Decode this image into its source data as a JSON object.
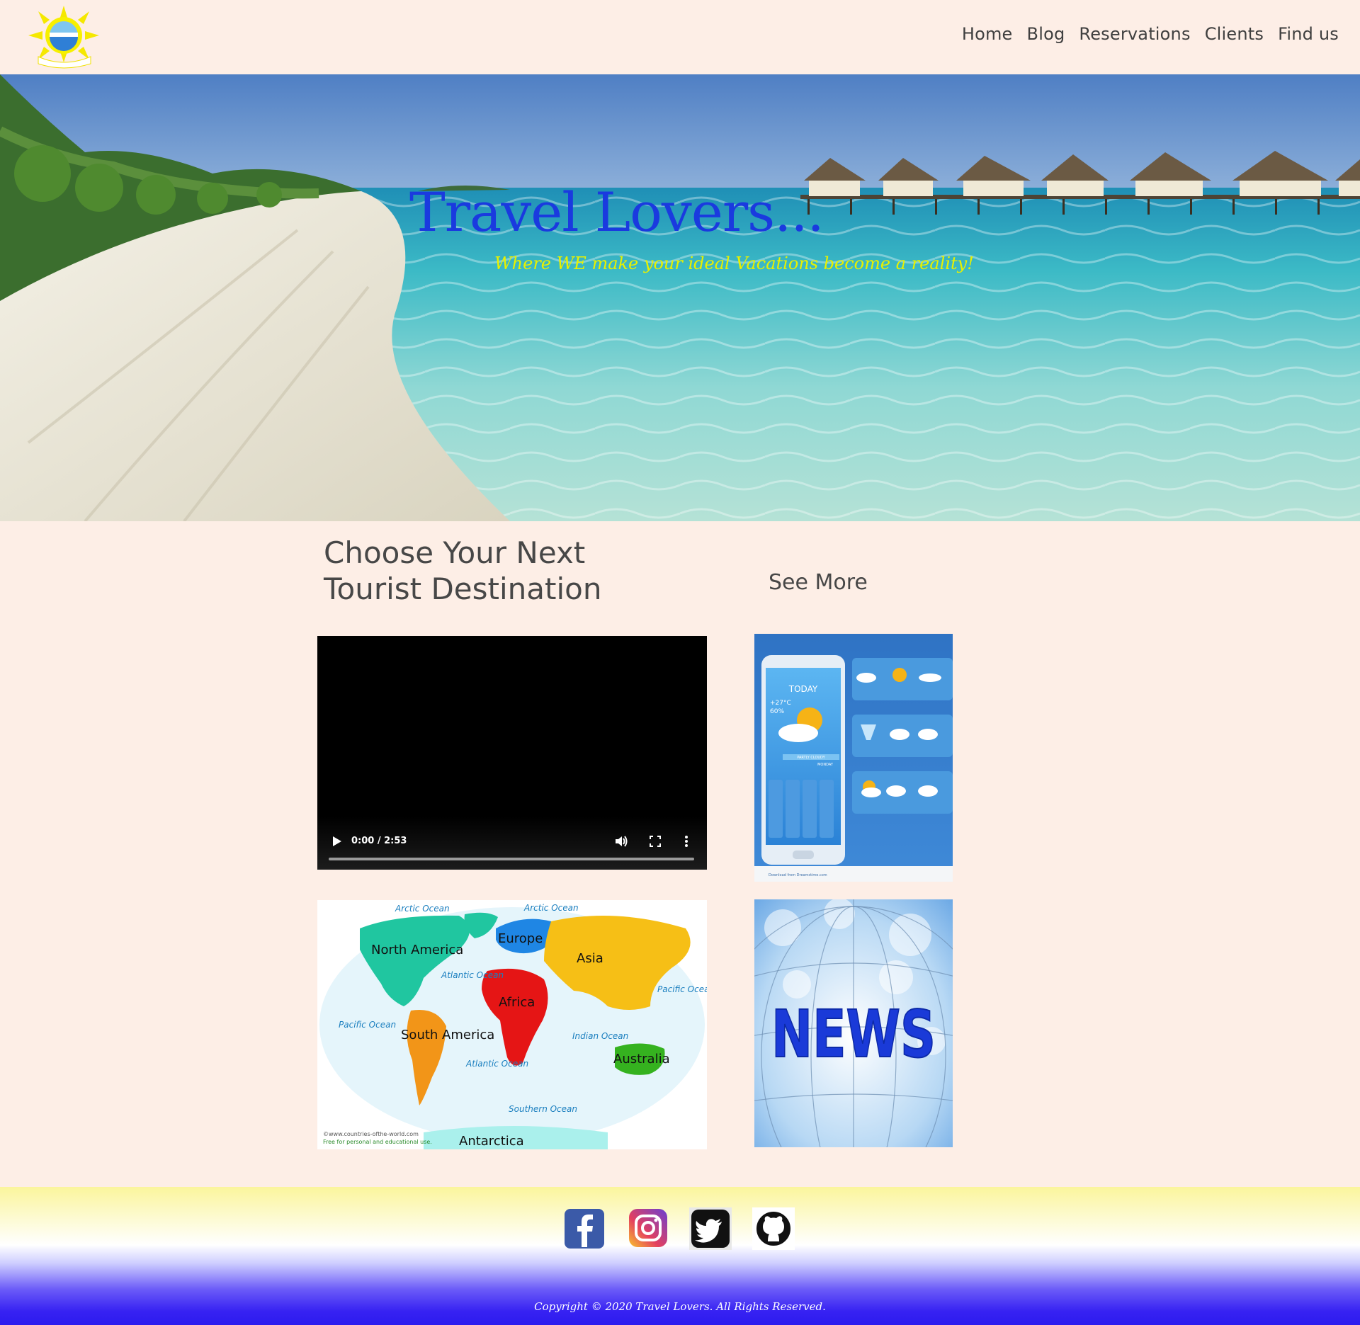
{
  "header": {
    "logo_text": "Travel Lovers",
    "nav": [
      {
        "label": "Home"
      },
      {
        "label": "Blog"
      },
      {
        "label": "Reservations"
      },
      {
        "label": "Clients"
      },
      {
        "label": "Find us"
      }
    ]
  },
  "hero": {
    "title": "Travel Lovers...",
    "tagline": "Where WE make your ideal Vacations become a reality!"
  },
  "main": {
    "section_title": "Choose Your Next Tourist Destination",
    "see_more_label": "See More",
    "video": {
      "time_display": "0:00 / 2:53",
      "progress": 0
    },
    "weather_card": {
      "today_label": "TODAY",
      "temperature": "+27°C",
      "humidity": "60%",
      "status": "PARTLY CLOUDY",
      "day": "MONDAY",
      "source": "Download from Dreamstime.com"
    },
    "map_card": {
      "labels": {
        "arctic_ocean_1": "Arctic Ocean",
        "arctic_ocean_2": "Arctic Ocean",
        "north_america": "North America",
        "europe": "Europe",
        "asia": "Asia",
        "atlantic_ocean_1": "Atlantic Ocean",
        "pacific_ocean_1": "Pacific Ocean",
        "africa": "Africa",
        "pacific_ocean_2": "Pacific Ocean",
        "south_america": "South America",
        "indian_ocean": "Indian Ocean",
        "atlantic_ocean_2": "Atlantic Ocean",
        "australia": "Australia",
        "southern_ocean": "Southern Ocean",
        "antarctica": "Antarctica"
      },
      "credit_line_1": "©www.countries-ofthe-world.com",
      "credit_line_2": "Free for personal and educational use."
    },
    "news_card": {
      "text": "NEWS"
    }
  },
  "footer": {
    "social": [
      {
        "name": "facebook-icon"
      },
      {
        "name": "instagram-icon"
      },
      {
        "name": "twitter-icon"
      },
      {
        "name": "github-icon"
      }
    ],
    "copyright": "Copyright © 2020 Travel Lovers. All Rights Reserved."
  },
  "colors": {
    "page_bg": "#fdeee6",
    "hero_title": "#1a3adf",
    "hero_tagline": "#e8f100",
    "footer_top": "#fbf59c",
    "footer_bottom": "#2c1bee"
  }
}
